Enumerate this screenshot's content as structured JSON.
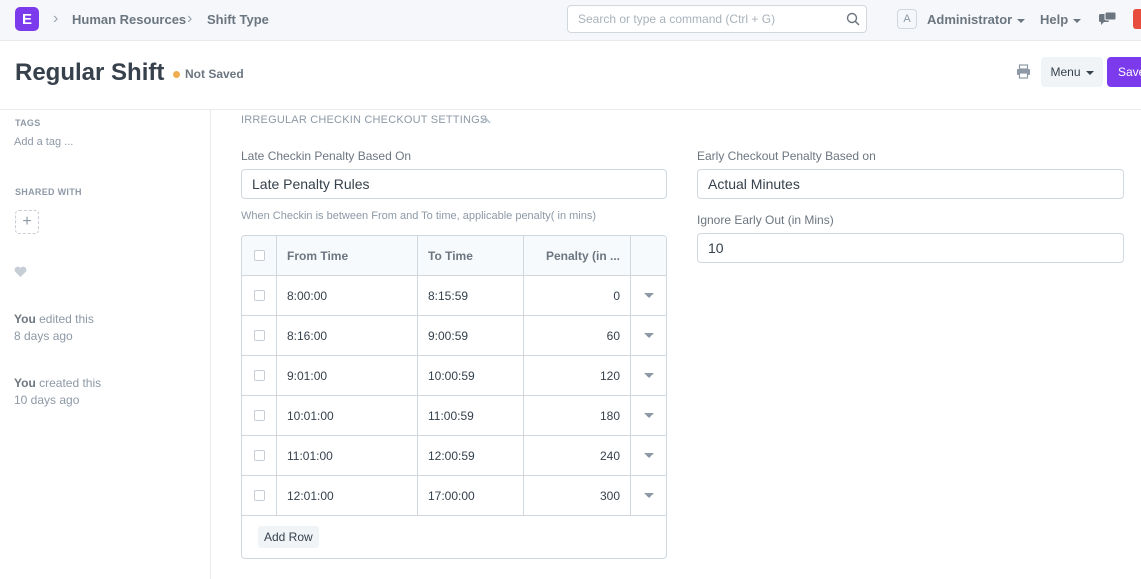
{
  "navbar": {
    "logo_letter": "E",
    "breadcrumbs": [
      "Human Resources",
      "Shift Type"
    ],
    "search_placeholder": "Search or type a command (Ctrl + G)",
    "avatar_letter": "A",
    "user_label": "Administrator",
    "help_label": "Help"
  },
  "page": {
    "title": "Regular Shift",
    "status": "Not Saved",
    "status_color": "#f0ad4e",
    "menu_label": "Menu",
    "save_label": "Save",
    "accent_color": "#7c3aed"
  },
  "sidebar": {
    "tags_label": "TAGS",
    "add_tag": "Add a tag ...",
    "shared_with_label": "SHARED WITH",
    "share_add": "+",
    "activity": [
      {
        "who": "You",
        "action": " edited this",
        "when": "8 days ago"
      },
      {
        "who": "You",
        "action": " created this",
        "when": "10 days ago"
      }
    ]
  },
  "section": {
    "heading": "IRREGULAR CHECKIN CHECKOUT SETTINGS",
    "late_penalty_label": "Late Checkin Penalty Based On",
    "late_penalty_value": "Late Penalty Rules",
    "help_text": "When Checkin is between From and To time, applicable penalty( in mins)",
    "early_penalty_label": "Early Checkout Penalty Based on",
    "early_penalty_value": "Actual Minutes",
    "ignore_early_label": "Ignore Early Out (in Mins)",
    "ignore_early_value": "10"
  },
  "grid": {
    "columns": [
      "From Time",
      "To Time",
      "Penalty (in ..."
    ],
    "rows": [
      {
        "from": "8:00:00",
        "to": "8:15:59",
        "penalty": "0"
      },
      {
        "from": "8:16:00",
        "to": "9:00:59",
        "penalty": "60"
      },
      {
        "from": "9:01:00",
        "to": "10:00:59",
        "penalty": "120"
      },
      {
        "from": "10:01:00",
        "to": "11:00:59",
        "penalty": "180"
      },
      {
        "from": "11:01:00",
        "to": "12:00:59",
        "penalty": "240"
      },
      {
        "from": "12:01:00",
        "to": "17:00:00",
        "penalty": "300"
      }
    ],
    "add_row_label": "Add Row"
  }
}
